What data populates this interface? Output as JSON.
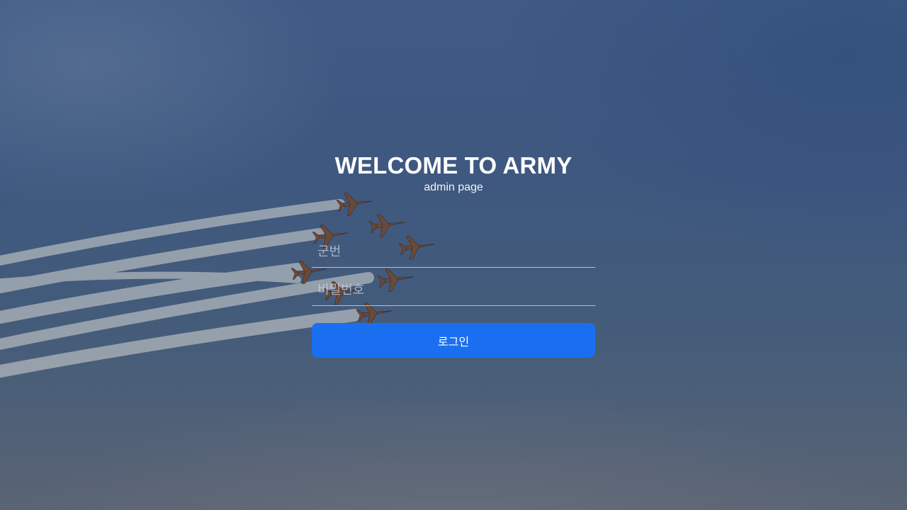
{
  "login": {
    "title": "WELCOME TO ARMY",
    "subtitle": "admin page",
    "id_placeholder": "군번",
    "password_placeholder": "비밀번호",
    "login_button": "로그인"
  },
  "colors": {
    "accent": "#1a6ff0",
    "background": "#3f5a84"
  },
  "background": {
    "image_subject": "jet-formation-with-smoke-trails"
  }
}
